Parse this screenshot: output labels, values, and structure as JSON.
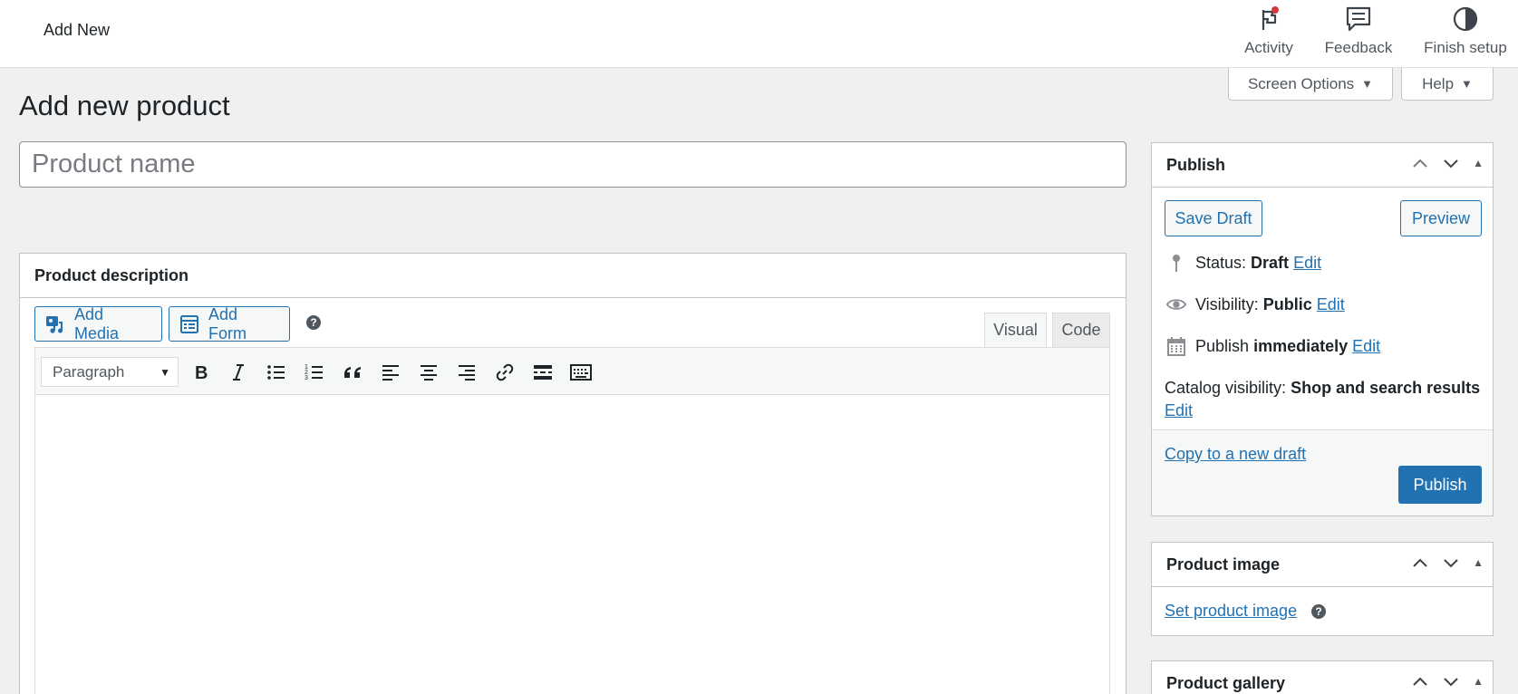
{
  "topbar": {
    "title": "Add New",
    "activity_label": "Activity",
    "feedback_label": "Feedback",
    "finish_setup_label": "Finish setup"
  },
  "screen_meta": {
    "screen_options_label": "Screen Options",
    "help_label": "Help"
  },
  "page": {
    "title": "Add new product",
    "title_placeholder": "Product name"
  },
  "description": {
    "header": "Product description",
    "add_media_label": "Add Media",
    "add_form_label": "Add Form",
    "help_glyph": "?",
    "tab_visual": "Visual",
    "tab_code": "Code",
    "format_value": "Paragraph",
    "toolbar_icons": [
      "bold-icon",
      "italic-icon",
      "bullet-list-icon",
      "numbered-list-icon",
      "blockquote-icon",
      "align-left-icon",
      "align-center-icon",
      "align-right-icon",
      "link-icon",
      "read-more-icon",
      "toolbar-toggle-icon"
    ]
  },
  "publish": {
    "header": "Publish",
    "save_draft_label": "Save Draft",
    "preview_label": "Preview",
    "status_label": "Status:",
    "status_value": "Draft",
    "visibility_label": "Visibility:",
    "visibility_value": "Public",
    "publish_label": "Publish",
    "publish_value": "immediately",
    "catalog_label": "Catalog visibility:",
    "catalog_value": "Shop and search results",
    "edit_label": "Edit",
    "copy_draft_label": "Copy to a new draft",
    "publish_button_label": "Publish"
  },
  "product_image": {
    "header": "Product image",
    "set_image_label": "Set product image"
  },
  "product_gallery": {
    "header": "Product gallery"
  },
  "colors": {
    "accent": "#2271b1",
    "background": "#f0f0f1",
    "notification_dot": "#d63638"
  }
}
